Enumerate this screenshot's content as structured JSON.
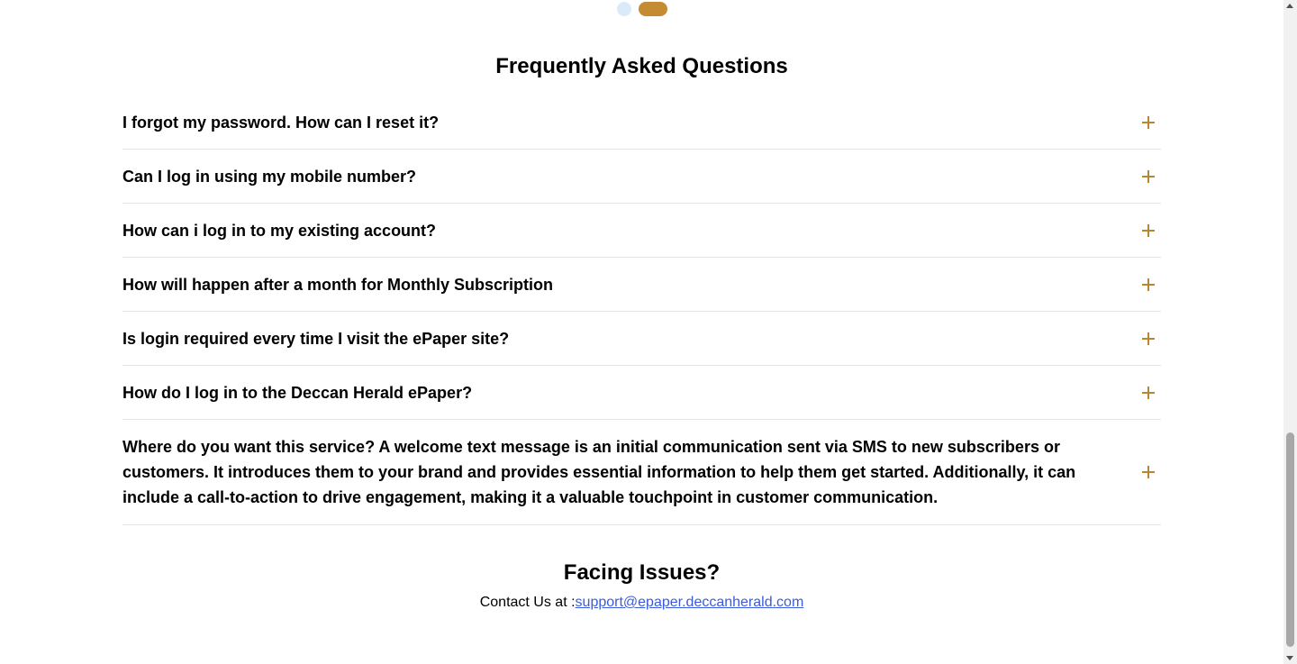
{
  "faq": {
    "title": "Frequently Asked Questions",
    "items": [
      {
        "question": "I forgot my password. How can I reset it?"
      },
      {
        "question": "Can I log in using my mobile number?"
      },
      {
        "question": "How can i log in to my existing account?"
      },
      {
        "question": "How will happen after a month for Monthly Subscription"
      },
      {
        "question": "Is login required every time I visit the ePaper site?"
      },
      {
        "question": "How do I log in to the Deccan Herald ePaper?"
      },
      {
        "question": "Where do you want this service? A welcome text message is an initial communication sent via SMS to new subscribers or customers. It introduces them to your brand and provides essential information to help them get started. Additionally, it can include a call-to-action to drive engagement, making it a valuable touchpoint in customer communication."
      }
    ]
  },
  "issues": {
    "title": "Facing Issues?",
    "contact_prefix": "Contact Us at :",
    "email": "support@epaper.deccanherald.com"
  },
  "colors": {
    "accent": "#c48b33",
    "dot_inactive": "#dbeafa",
    "link": "#3b5bdb"
  },
  "icons": {
    "expand": "plus-icon"
  }
}
